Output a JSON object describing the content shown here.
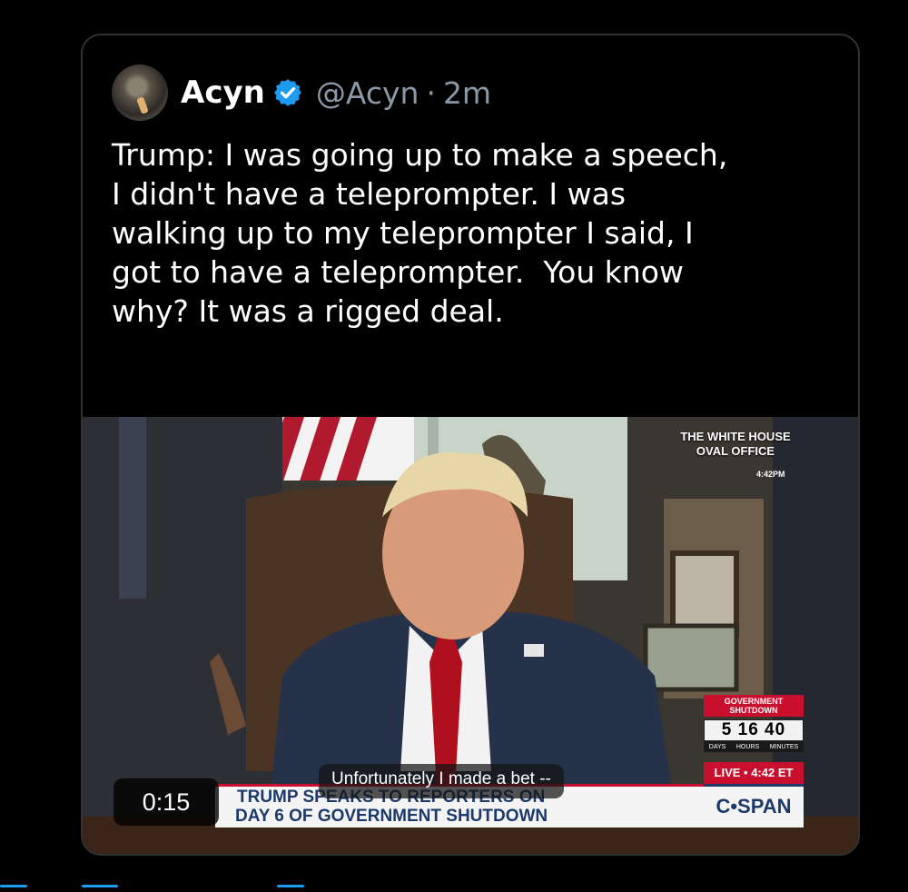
{
  "tweet": {
    "display_name": "Acyn",
    "handle": "@Acyn",
    "separator": "·",
    "time": "2m",
    "verified_color": "#1d9bf0",
    "text": "Trump: I was going up to make a speech,\nI didn't have a teleprompter. I was\nwalking up to my teleprompter I said, I\ngot to have a teleprompter.  You know\nwhy? It was a rigged deal."
  },
  "video": {
    "network_label": "THE WHITE HOUSE\nOVAL OFFICE",
    "network_time": "4:42PM",
    "shutdown_label": "GOVERNMENT\nSHUTDOWN",
    "counter": "5 16 40",
    "counter_units": [
      "DAYS",
      "HOURS",
      "MINUTES"
    ],
    "live_label": "LIVE • 4:42 ET",
    "lower_third_line1": "TRUMP SPEAKS TO REPORTERS ON",
    "lower_third_line2": "DAY 6 OF GOVERNMENT SHUTDOWN",
    "channel": "C•SPAN",
    "caption": "Unfortunately I made a bet --",
    "timestamp": "0:15"
  }
}
